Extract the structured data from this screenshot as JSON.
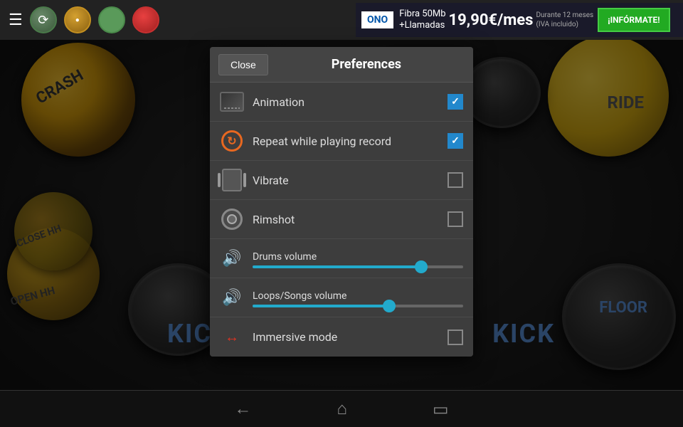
{
  "topbar": {
    "hamburger": "☰",
    "buttons": [
      "⟳",
      "●",
      "■",
      "●"
    ]
  },
  "ad": {
    "brand": "ONO",
    "line1": "Fibra 50Mb",
    "line2": "+Llamadas",
    "price": "19,90€/mes",
    "detail1": "Durante 12 meses",
    "detail2": "(IVA incluido)",
    "cta": "¡INFÓRMATE!"
  },
  "bottomnav": {
    "back": "←",
    "home": "⌂",
    "recent": "▭"
  },
  "dialog": {
    "close_label": "Close",
    "title": "Preferences",
    "items": [
      {
        "id": "animation",
        "label": "Animation",
        "type": "checkbox",
        "checked": true
      },
      {
        "id": "repeat",
        "label": "Repeat while playing record",
        "type": "checkbox",
        "checked": true
      },
      {
        "id": "vibrate",
        "label": "Vibrate",
        "type": "checkbox",
        "checked": false
      },
      {
        "id": "rimshot",
        "label": "Rimshot",
        "type": "checkbox",
        "checked": false
      },
      {
        "id": "drums_volume",
        "label": "Drums volume",
        "type": "slider",
        "value": 80,
        "icon_color": "blue"
      },
      {
        "id": "loops_volume",
        "label": "Loops/Songs volume",
        "type": "slider",
        "value": 65,
        "icon_color": "purple"
      },
      {
        "id": "immersive",
        "label": "Immersive mode",
        "type": "checkbox",
        "checked": false
      }
    ]
  },
  "drum_labels": {
    "crash": "CRASH",
    "ride": "RIDE",
    "open_hh": "OPEN HH",
    "close_hh": "CLOSE HH",
    "kick_left": "KICK",
    "kick_right": "KICK",
    "floor": "FLOOR"
  }
}
